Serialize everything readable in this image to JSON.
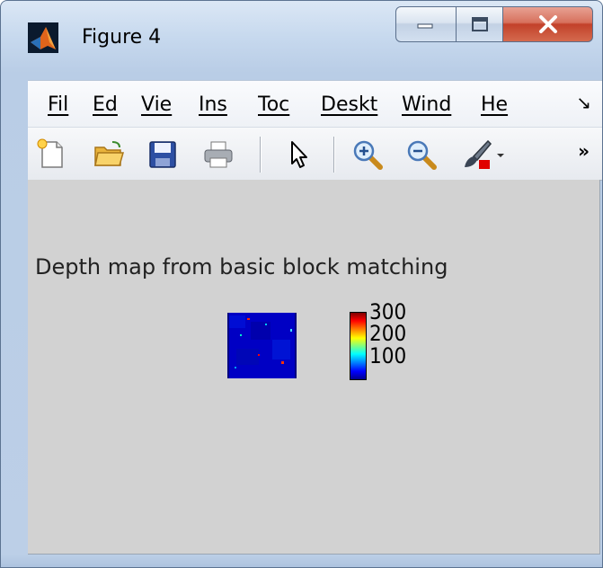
{
  "window": {
    "title": "Figure 4",
    "controls": [
      "minimize",
      "maximize",
      "close"
    ]
  },
  "menubar": {
    "items": [
      "Fil",
      "Ed",
      "Vie",
      "Ins",
      "Toc",
      "Deskt",
      "Wind",
      "He"
    ],
    "more_glyph": "↘"
  },
  "toolbar": {
    "tools": [
      "new-figure-icon",
      "open-folder-icon",
      "save-icon",
      "print-icon",
      "pointer-arrow-icon",
      "zoom-in-icon",
      "zoom-out-icon",
      "brush-icon"
    ],
    "more_glyph": "»"
  },
  "figure": {
    "title": "Depth map from basic block matching",
    "colorbar": {
      "ticks": [
        "300",
        "200",
        "100"
      ],
      "colormap": "jet"
    }
  }
}
